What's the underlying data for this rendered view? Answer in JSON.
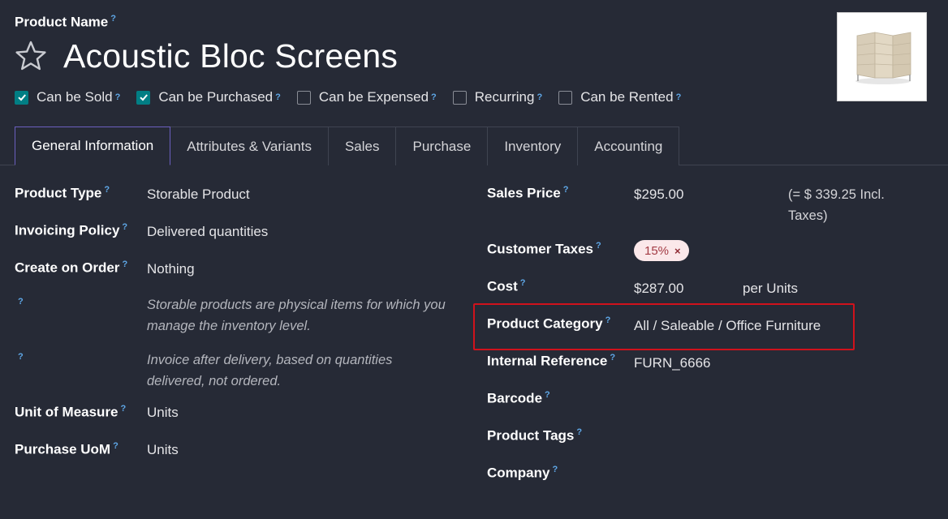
{
  "header": {
    "name_label": "Product Name",
    "product_name": "Acoustic Bloc Screens",
    "help_mark": "?"
  },
  "options": [
    {
      "label": "Can be Sold",
      "checked": true
    },
    {
      "label": "Can be Purchased",
      "checked": true
    },
    {
      "label": "Can be Expensed",
      "checked": false
    },
    {
      "label": "Recurring",
      "checked": false
    },
    {
      "label": "Can be Rented",
      "checked": false
    }
  ],
  "tabs": [
    {
      "label": "General Information",
      "active": true
    },
    {
      "label": "Attributes & Variants",
      "active": false
    },
    {
      "label": "Sales",
      "active": false
    },
    {
      "label": "Purchase",
      "active": false
    },
    {
      "label": "Inventory",
      "active": false
    },
    {
      "label": "Accounting",
      "active": false
    }
  ],
  "left": {
    "product_type": {
      "label": "Product Type",
      "value": "Storable Product"
    },
    "invoicing_policy": {
      "label": "Invoicing Policy",
      "value": "Delivered quantities"
    },
    "create_on_order": {
      "label": "Create on Order",
      "value": "Nothing"
    },
    "help_type_line1": "Storable products are physical items for which you",
    "help_type_line2": "manage the inventory level.",
    "help_invoice_line1": "Invoice after delivery, based on quantities",
    "help_invoice_line2": "delivered, not ordered.",
    "uom": {
      "label": "Unit of Measure",
      "value": "Units"
    },
    "purchase_uom": {
      "label": "Purchase UoM",
      "value": "Units"
    }
  },
  "right": {
    "sales_price": {
      "label": "Sales Price",
      "value": "$295.00",
      "incl_line1": "(= $ 339.25 Incl.",
      "incl_line2": "Taxes)"
    },
    "customer_taxes": {
      "label": "Customer Taxes",
      "tax": "15%",
      "remove": "×"
    },
    "cost": {
      "label": "Cost",
      "value": "$287.00",
      "per": "per Units"
    },
    "category": {
      "label": "Product Category",
      "value": "All / Saleable / Office Furniture"
    },
    "internal_ref": {
      "label": "Internal Reference",
      "value": "FURN_6666"
    },
    "barcode": {
      "label": "Barcode"
    },
    "tags": {
      "label": "Product Tags"
    },
    "company": {
      "label": "Company"
    }
  },
  "colors": {
    "background": "#262a36",
    "checkbox_on": "#017e84",
    "help_mark": "#5fa8e8",
    "active_tab_border": "#6b5fbf",
    "highlight": "#d0121c",
    "tax_badge_bg": "#fbe8ea",
    "tax_badge_text": "#a33b44"
  }
}
